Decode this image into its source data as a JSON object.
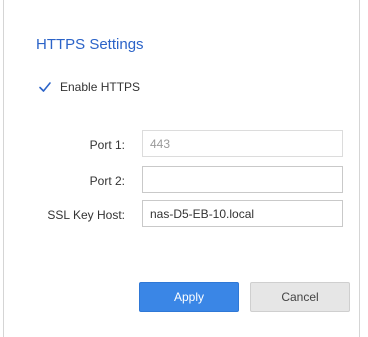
{
  "dialog": {
    "title": "HTTPS Settings",
    "accent_color": "#2b63c8"
  },
  "enable_https": {
    "label": "Enable HTTPS",
    "checked": true,
    "icon": "check-icon"
  },
  "fields": {
    "port1": {
      "label": "Port 1:",
      "value": "443",
      "disabled": true
    },
    "port2": {
      "label": "Port 2:",
      "value": ""
    },
    "ssl_key_host": {
      "label": "SSL Key Host:",
      "value": "nas-D5-EB-10.local"
    }
  },
  "buttons": {
    "apply_label": "Apply",
    "apply_color": "#3a86e6",
    "cancel_label": "Cancel"
  }
}
